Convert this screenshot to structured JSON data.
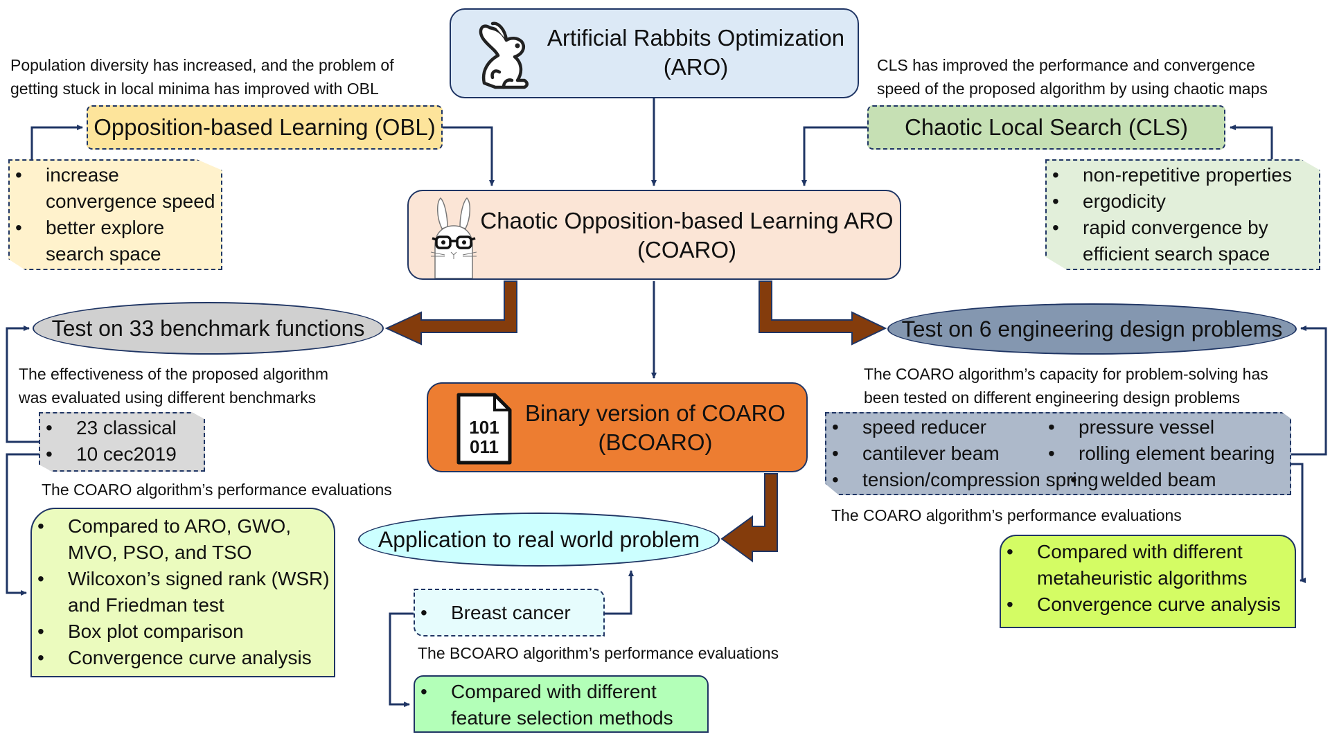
{
  "nodes": {
    "aro": {
      "title": "Artificial Rabbits Optimization",
      "subtitle": "(ARO)",
      "icon": "rabbit-icon",
      "color": "#dce9f6"
    },
    "obl": {
      "title": "Opposition-based Learning (OBL)",
      "color": "#fde49b"
    },
    "cls": {
      "title": "Chaotic Local Search (CLS)",
      "color": "#c6e0b4"
    },
    "coaro": {
      "title": "Chaotic Opposition-based Learning ARO",
      "subtitle": "(COARO)",
      "icon": "rabbit-glasses-icon",
      "color": "#fbe5d6"
    },
    "benchmark": {
      "title": "Test on 33 benchmark functions",
      "color": "#d0d0d0"
    },
    "engineering": {
      "title": "Test on 6 engineering design problems",
      "color": "#8497b0"
    },
    "bcoaro": {
      "title": "Binary version of COARO",
      "subtitle": "(BCOARO)",
      "icon": "binary-file-icon",
      "icon_text": [
        "101",
        "011"
      ],
      "color": "#ed7d31"
    },
    "application": {
      "title": "Application to real world problem",
      "color": "#ccffff"
    }
  },
  "notes": {
    "obl_note": [
      "Population diversity has increased, and the problem of",
      "getting stuck in local minima has improved with OBL"
    ],
    "cls_note": [
      "CLS has improved the performance and convergence",
      "speed of the proposed algorithm by using chaotic maps"
    ],
    "benchmark_note": [
      "The effectiveness of the proposed algorithm",
      "was evaluated using different benchmarks"
    ],
    "benchmark_perf": "The COARO algorithm’s performance evaluations",
    "engineering_note": [
      "The COARO algorithm’s capacity for problem-solving has",
      "been tested on different engineering design problems"
    ],
    "engineering_perf": "The COARO algorithm’s performance evaluations",
    "bcoaro_perf": "The BCOARO algorithm’s performance evaluations"
  },
  "lists": {
    "obl_benefits": {
      "items": [
        "increase",
        "convergence speed",
        "better explore",
        "search space"
      ],
      "bullets": [
        true,
        false,
        true,
        false
      ],
      "color": "#fff2cc"
    },
    "cls_benefits": {
      "items": [
        "non-repetitive properties",
        "ergodicity",
        "rapid convergence by",
        "efficient search space"
      ],
      "bullets": [
        true,
        true,
        true,
        false
      ],
      "color": "#e2efda"
    },
    "benchmarks": {
      "items": [
        "23 classical",
        "10 cec2019"
      ],
      "color": "#d9d9d9"
    },
    "benchmark_eval": {
      "items": [
        "Compared to ARO, GWO,",
        "MVO, PSO, and TSO",
        "Wilcoxon’s signed rank (WSR)",
        "and Friedman test",
        "Box plot comparison",
        "Convergence curve analysis"
      ],
      "bullets": [
        true,
        false,
        true,
        false,
        true,
        true
      ],
      "color": "#ebfbbe"
    },
    "engineering_problems": {
      "col1": [
        "speed reducer",
        "cantilever beam",
        "tension/compression spring"
      ],
      "col2": [
        "pressure vessel",
        "rolling element bearing",
        "welded beam"
      ],
      "color": "#adb9ca"
    },
    "engineering_eval": {
      "items": [
        "Compared with different",
        "metaheuristic algorithms",
        "Convergence curve analysis"
      ],
      "bullets": [
        true,
        false,
        true
      ],
      "color": "#d4fc64"
    },
    "datasets": {
      "items": [
        "Breast cancer"
      ],
      "color": "#e6fcfd"
    },
    "feature_eval": {
      "items": [
        "Compared with different",
        "feature selection methods"
      ],
      "bullets": [
        true,
        false
      ],
      "color": "#b3ffb8"
    }
  },
  "colors": {
    "line": "#1f3564",
    "thick_arrow": "#843c0c"
  }
}
